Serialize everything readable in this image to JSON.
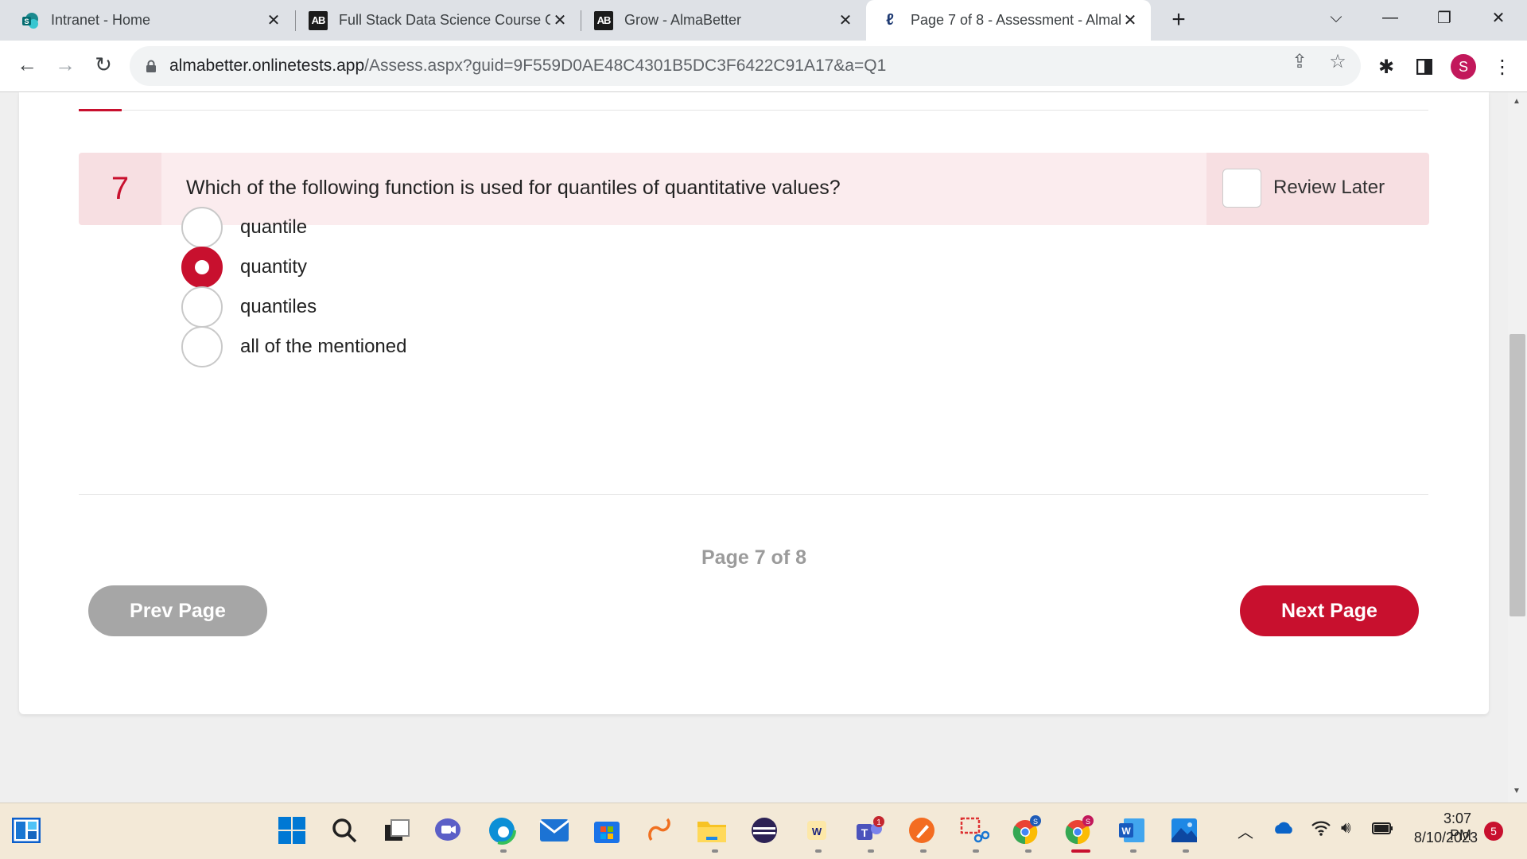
{
  "browser": {
    "tabs": [
      {
        "title": "Intranet - Home",
        "icon": "sharepoint-icon",
        "active": false
      },
      {
        "title": "Full Stack Data Science Course O",
        "icon": "almabetter-icon",
        "active": false
      },
      {
        "title": "Grow - AlmaBetter",
        "icon": "almabetter-icon",
        "active": false
      },
      {
        "title": "Page 7 of 8 - Assessment - Almal",
        "icon": "assessment-icon",
        "active": true
      }
    ],
    "new_tab": "+",
    "url_host": "almabetter.onlinetests.app",
    "url_path": "/Assess.aspx?guid=9F559D0AE48C4301B5DC3F6422C91A17&a=Q1",
    "profile_initial": "S"
  },
  "question": {
    "number": "7",
    "text": "Which of the following function is used for quantiles of quantitative values?",
    "review_label": "Review Later",
    "options": [
      {
        "label": "quantile",
        "selected": false
      },
      {
        "label": "quantity",
        "selected": true
      },
      {
        "label": "quantiles",
        "selected": false
      },
      {
        "label": "all of the mentioned",
        "selected": false
      }
    ]
  },
  "pagination": {
    "indicator": "Page 7 of 8",
    "prev_label": "Prev Page",
    "next_label": "Next Page"
  },
  "taskbar": {
    "time": "3:07 PM",
    "date": "8/10/2023",
    "notification_count": "5",
    "teams_badge": "1"
  },
  "colors": {
    "accent": "#c8102e",
    "question_bg": "#fbecee",
    "prev_button": "#a6a6a6"
  }
}
